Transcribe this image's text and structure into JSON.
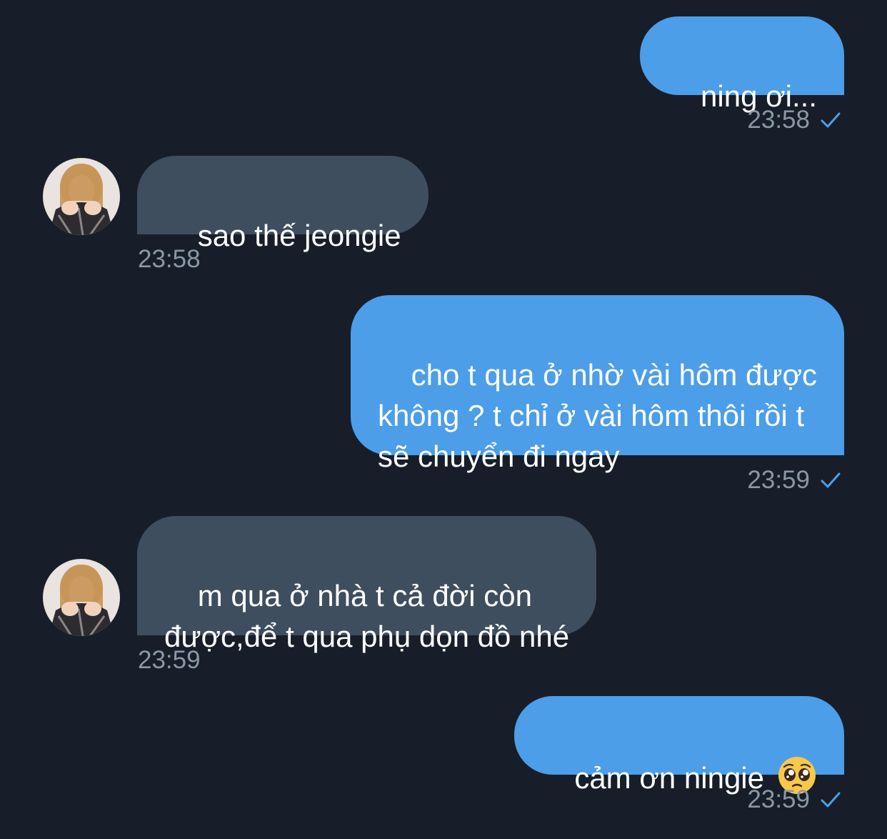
{
  "messages": [
    {
      "direction": "out",
      "text": "ning ơi...",
      "time": "23:58",
      "status": "sent-check-icon"
    },
    {
      "direction": "in",
      "text": "sao thế jeongie",
      "time": "23:58"
    },
    {
      "direction": "out",
      "text": "cho t qua ở nhờ vài hôm được\nkhông ? t chỉ ở vài hôm thôi rồi t\nsẽ chuyển đi ngay",
      "time": "23:59",
      "status": "sent-check-icon"
    },
    {
      "direction": "in",
      "text": "m qua ở nhà t cả đời còn\nđược,để t qua phụ dọn đồ nhé",
      "time": "23:59"
    },
    {
      "direction": "out",
      "text": "cảm ơn ningie",
      "emoji": "pleading-face-emoji",
      "time": "23:59",
      "status": "sent-check-icon"
    }
  ],
  "colors": {
    "background": "#171e29",
    "outgoing_bubble": "#4c9ee8",
    "incoming_bubble": "#3f4e5e",
    "timestamp": "#8b98a5",
    "check": "#4c9ee8"
  }
}
